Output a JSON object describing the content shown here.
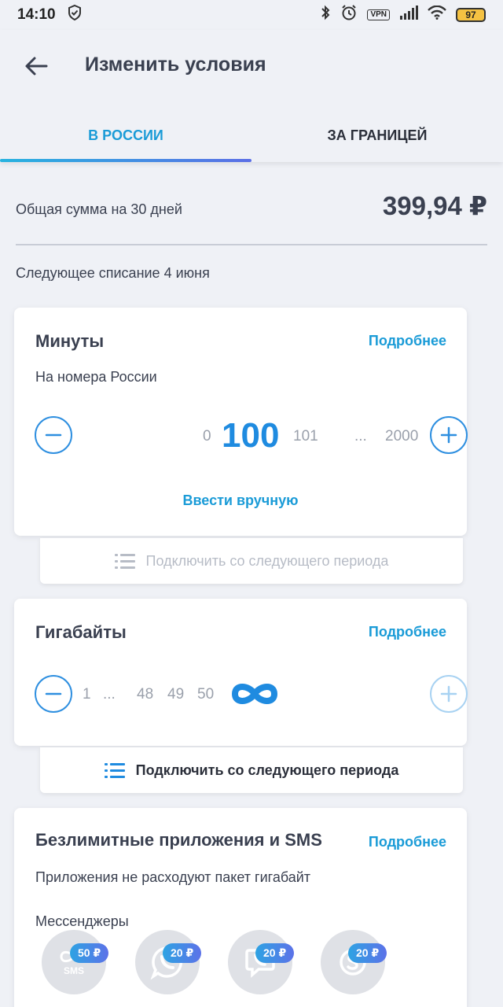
{
  "status_bar": {
    "time": "14:10",
    "vpn": "VPN",
    "battery": "97"
  },
  "header": {
    "title": "Изменить условия"
  },
  "tabs": [
    {
      "label": "В РОССИИ",
      "active": true
    },
    {
      "label": "ЗА ГРАНИЦЕЙ",
      "active": false
    }
  ],
  "summary": {
    "label": "Общая сумма на 30 дней",
    "value": "399,94 ₽",
    "next_charge": "Следующее списание 4 июня"
  },
  "minutes": {
    "title": "Минуты",
    "more": "Подробнее",
    "subtitle": "На номера России",
    "values": {
      "min": "0",
      "current": "100",
      "next": "101",
      "ellipsis": "...",
      "max": "2000"
    },
    "manual": "Ввести вручную",
    "next_period": "Подключить со следующего периода"
  },
  "gigabytes": {
    "title": "Гигабайты",
    "more": "Подробнее",
    "values": {
      "first": "1",
      "ellipsis": "...",
      "v48": "48",
      "v49": "49",
      "v50": "50"
    },
    "next_period": "Подключить со следующего периода"
  },
  "unlimited": {
    "title": "Безлимитные приложения и SMS",
    "more": "Подробнее",
    "subtitle": "Приложения не расходуют пакет гигабайт",
    "section": "Мессенджеры",
    "apps": [
      {
        "icon": "sms-infinity-icon",
        "label": "SMS",
        "price": "50 ₽"
      },
      {
        "icon": "whatsapp-icon",
        "price": "20 ₽"
      },
      {
        "icon": "viber-icon",
        "price": "20 ₽"
      },
      {
        "icon": "skype-icon",
        "price": "20 ₽"
      }
    ]
  },
  "colors": {
    "accent": "#1a9bd7",
    "number": "#1f8be0",
    "background": "#eff1f6"
  }
}
